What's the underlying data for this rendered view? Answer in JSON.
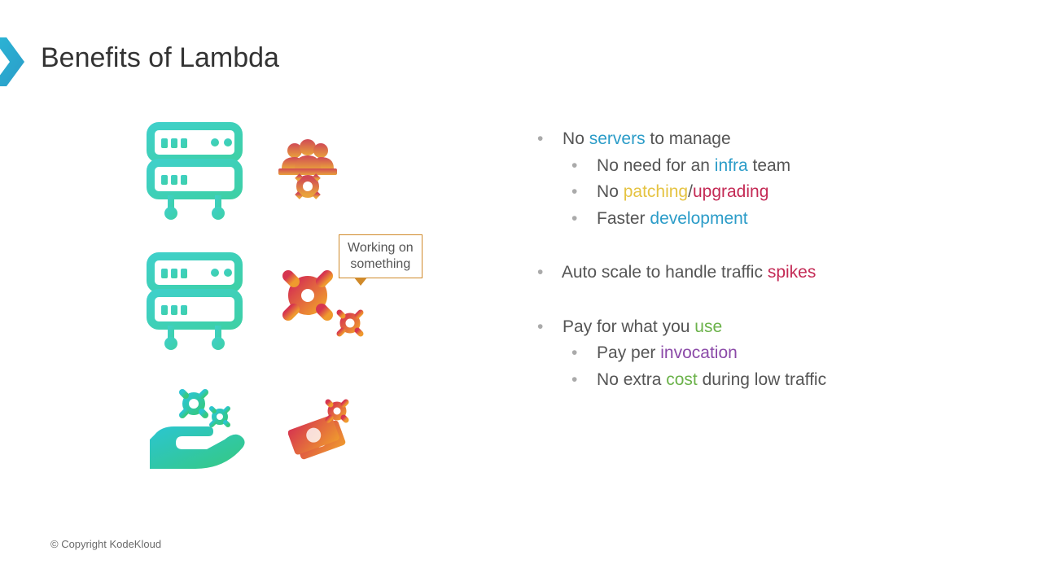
{
  "title": "Benefits of Lambda",
  "speech": "Working on\nsomething",
  "bullets": {
    "b1_pre": "No ",
    "b1_hl": "servers",
    "b1_post": " to manage",
    "b1a_pre": "No need for an ",
    "b1a_hl": "infra",
    "b1a_post": " team",
    "b1b_pre": "No ",
    "b1b_hl1": "patching",
    "b1b_mid": "/",
    "b1b_hl2": "upgrading",
    "b1c_pre": "Faster ",
    "b1c_hl": "development",
    "b2_pre": "Auto scale to handle traffic ",
    "b2_hl": "spikes",
    "b3_pre": "Pay for what you ",
    "b3_hl": "use",
    "b3a_pre": "Pay per ",
    "b3a_hl": "invocation",
    "b3b_pre": "No extra ",
    "b3b_hl": "cost",
    "b3b_post": " during low traffic"
  },
  "footer": "© Copyright KodeKloud"
}
